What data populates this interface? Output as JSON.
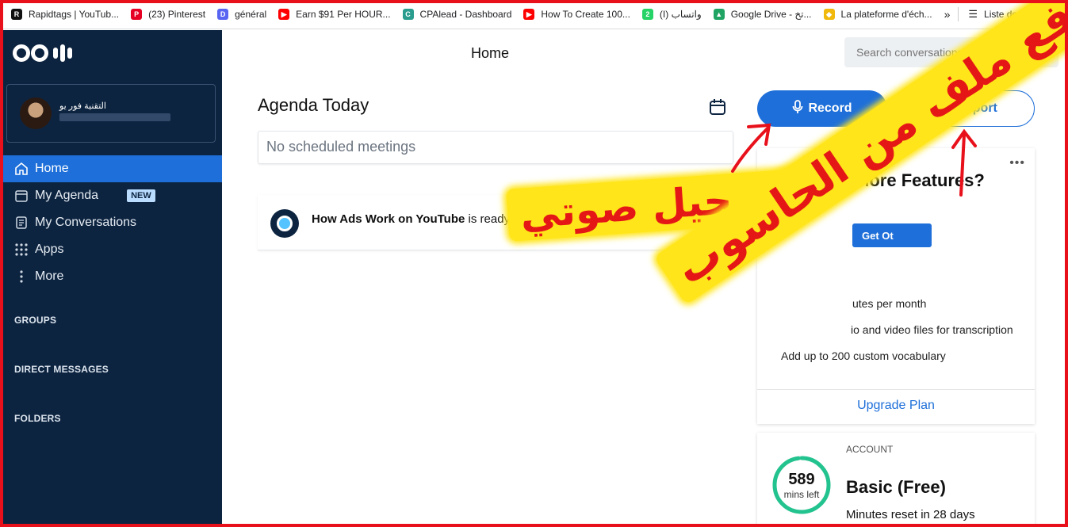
{
  "bookmarks": [
    {
      "label": "Rapidtags | YouTub...",
      "icon": "rapidtags-icon",
      "color": "#111111",
      "glyph": "R"
    },
    {
      "label": "(23) Pinterest",
      "icon": "pinterest-icon",
      "color": "#e60023",
      "glyph": "P"
    },
    {
      "label": "général",
      "icon": "discord-icon",
      "color": "#5865f2",
      "glyph": "D"
    },
    {
      "label": "Earn $91 Per HOUR...",
      "icon": "youtube-icon",
      "color": "#ff0000",
      "glyph": "▶"
    },
    {
      "label": "CPAlead - Dashboard",
      "icon": "cpalead-icon",
      "color": "#2a9d8f",
      "glyph": "C"
    },
    {
      "label": "How To Create 100...",
      "icon": "youtube-icon",
      "color": "#ff0000",
      "glyph": "▶"
    },
    {
      "label": "(I) واتساب",
      "icon": "whatsapp-icon",
      "color": "#25d366",
      "glyph": "2"
    },
    {
      "label": "Google Drive - تخ...",
      "icon": "google-drive-icon",
      "color": "#1fa463",
      "glyph": "▲"
    },
    {
      "label": "La plateforme d'éch...",
      "icon": "binance-icon",
      "color": "#f0b90b",
      "glyph": "◆"
    }
  ],
  "bookmarks_more": "»",
  "reading_list": "Liste de lectu",
  "sidebar": {
    "profile_name": "التقنية فور يو",
    "nav": [
      {
        "label": "Home",
        "icon": "home-icon",
        "active": true
      },
      {
        "label": "My Agenda",
        "icon": "calendar-icon",
        "badge": "NEW"
      },
      {
        "label": "My Conversations",
        "icon": "document-icon"
      },
      {
        "label": "Apps",
        "icon": "grid-icon"
      },
      {
        "label": "More",
        "icon": "more-vertical-icon"
      }
    ],
    "sections": [
      "GROUPS",
      "DIRECT MESSAGES",
      "FOLDERS"
    ]
  },
  "header": {
    "title": "Home",
    "search_placeholder": "Search conversations..."
  },
  "agenda": {
    "title": "Agenda Today",
    "empty_text": "No scheduled meetings"
  },
  "conversation": {
    "title": "How Ads Work on YouTube",
    "status": "is ready"
  },
  "actions": {
    "record_label": "Record",
    "import_label": "Import"
  },
  "features_card": {
    "title": "Need More Features?",
    "button_label": "Get Ot",
    "items": [
      "utes per month",
      "io and video files for transcription",
      "Add up to 200 custom vocabulary"
    ],
    "upgrade_label": "Upgrade Plan"
  },
  "account": {
    "label": "ACCOUNT",
    "minutes": "589",
    "minutes_label": "mins left",
    "minutes_remaining_fraction": 0.98,
    "plan": "Basic (Free)",
    "reset_text": "Minutes reset in 28 days"
  },
  "annotations": {
    "record_note": "تسجيل صوتي",
    "import_note": "رفع ملف من الحاسوب"
  },
  "colors": {
    "sidebar": "#0d2440",
    "accent": "#1e6fd9",
    "frame": "#e8101a",
    "highlight": "#ffe51a",
    "gauge": "#22c38e"
  }
}
